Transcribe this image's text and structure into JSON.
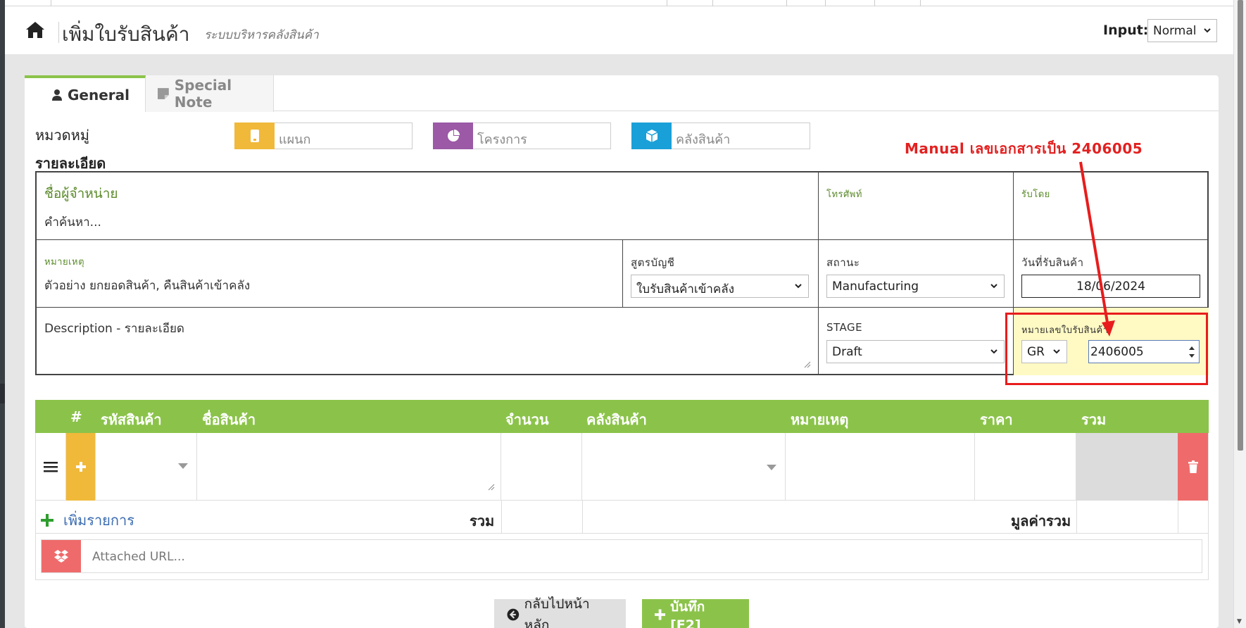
{
  "header": {
    "title": "เพิ่มใบรับสินค้า",
    "subtitle": "ระบบบริหารคลังสินค้า",
    "input_label": "Input:",
    "input_mode": "Normal"
  },
  "tabs": [
    {
      "label": "General",
      "icon": "user-icon",
      "active": true
    },
    {
      "label": "Special Note",
      "icon": "note-icon",
      "active": false
    }
  ],
  "category": {
    "label": "หมวดหมู่",
    "department_placeholder": "แผนก",
    "project_placeholder": "โครงการ",
    "warehouse_placeholder": "คลังสินค้า"
  },
  "details": {
    "label": "รายละเอียด",
    "supplier_label": "ชื่อผู้จำหน่าย",
    "supplier_placeholder": "คำค้นหา...",
    "phone_label": "โทรศัพท์",
    "received_by_label": "รับโดย",
    "remark_label": "หมายเหตุ",
    "remark_placeholder": "ตัวอย่าง ยกยอดสินค้า, คืนสินค้าเข้าคลัง",
    "formula_label": "สูตรบัญชี",
    "formula_value": "ใบรับสินค้าเข้าคลัง",
    "status_label": "สถานะ",
    "status_value": "Manufacturing",
    "receive_date_label": "วันที่รับสินค้า",
    "receive_date_value": "18/06/2024",
    "description_placeholder": "Description - รายละเอียด",
    "stage_label": "STAGE",
    "stage_value": "Draft",
    "doc_no_label": "หมายเลขใบรับสินค้า",
    "doc_prefix": "GR",
    "doc_number": "2406005"
  },
  "items_table": {
    "headers": [
      "#",
      "รหัสสินค้า",
      "ชื่อสินค้า",
      "จำนวน",
      "คลังสินค้า",
      "หมายเหตุ",
      "ราคา",
      "รวม"
    ],
    "add_item_label": "เพิ่มรายการ",
    "total_label": "รวม",
    "grand_total_label": "มูลค่ารวม",
    "attached_url_placeholder": "Attached URL..."
  },
  "buttons": {
    "back_label": "กลับไปหน้าหลัก",
    "save_label": "บันทึก [F2]"
  },
  "annotation": {
    "text": "Manual เลขเอกสารเป็น 2406005",
    "color": "#e81c1c"
  },
  "colors": {
    "accent_green": "#8bc34a",
    "department_icon_bg": "#f0b93a",
    "project_icon_bg": "#9b59a6",
    "warehouse_icon_bg": "#1aa0d8",
    "delete_bg": "#ef6b6b",
    "highlight_bg": "#fff9c4"
  }
}
